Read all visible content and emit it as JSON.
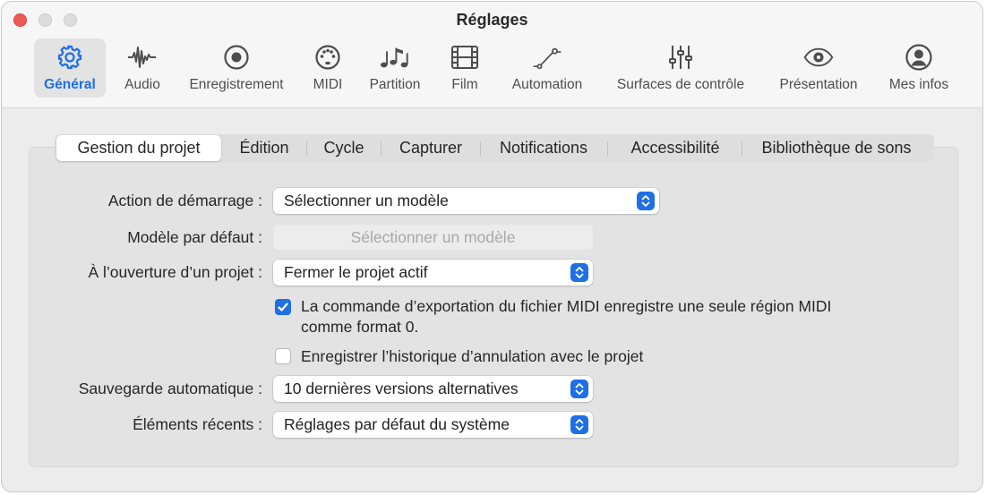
{
  "window": {
    "title": "Réglages"
  },
  "toolbar": {
    "items": [
      {
        "label": "Général",
        "icon": "gear-icon",
        "active": true
      },
      {
        "label": "Audio",
        "icon": "waveform-icon"
      },
      {
        "label": "Enregistrement",
        "icon": "record-icon"
      },
      {
        "label": "MIDI",
        "icon": "midi-icon"
      },
      {
        "label": "Partition",
        "icon": "notes-icon"
      },
      {
        "label": "Film",
        "icon": "film-icon"
      },
      {
        "label": "Automation",
        "icon": "automation-icon"
      },
      {
        "label": "Surfaces de contrôle",
        "icon": "sliders-icon"
      },
      {
        "label": "Présentation",
        "icon": "eye-icon"
      },
      {
        "label": "Mes infos",
        "icon": "person-icon"
      }
    ]
  },
  "tabs": [
    {
      "label": "Gestion du projet",
      "selected": true
    },
    {
      "label": "Édition"
    },
    {
      "label": "Cycle"
    },
    {
      "label": "Capturer"
    },
    {
      "label": "Notifications"
    },
    {
      "label": "Accessibilité"
    },
    {
      "label": "Bibliothèque de sons"
    }
  ],
  "form": {
    "startup_action": {
      "label": "Action de démarrage :",
      "value": "Sélectionner un modèle"
    },
    "default_template": {
      "label": "Modèle par défaut :",
      "button": "Sélectionner un modèle"
    },
    "on_open": {
      "label": "À l’ouverture d’un projet :",
      "value": "Fermer le projet actif"
    },
    "midi_export": {
      "line1": "La commande d’exportation du fichier MIDI enregistre une seule région MIDI",
      "line2": "comme format 0.",
      "checked": true
    },
    "undo_history": {
      "label": "Enregistrer l’historique d’annulation avec le projet",
      "checked": false
    },
    "autosave": {
      "label": "Sauvegarde automatique :",
      "value": "10 dernières versions alternatives"
    },
    "recent_items": {
      "label": "Éléments récents :",
      "value": "Réglages par défaut du système"
    }
  },
  "colors": {
    "accent": "#1f6fe5",
    "close": "#ee5b55"
  }
}
